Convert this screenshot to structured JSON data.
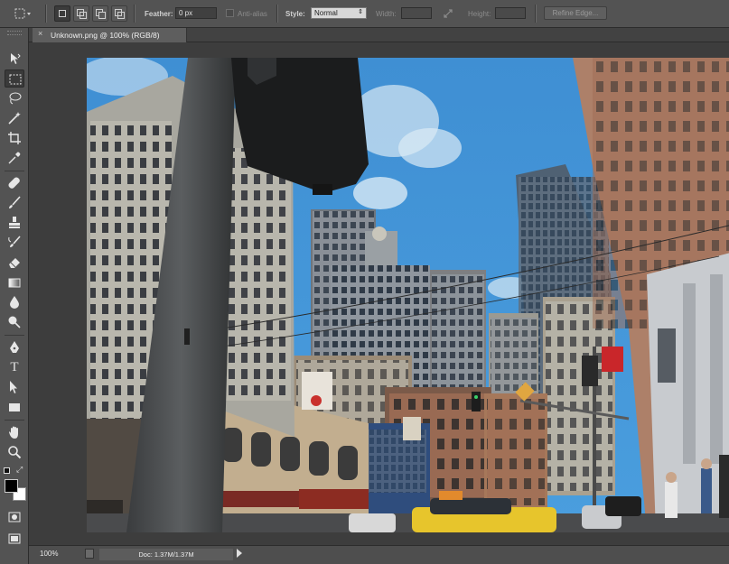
{
  "options_bar": {
    "feather_label": "Feather:",
    "feather_value": "0 px",
    "anti_alias_label": "Anti-alias",
    "style_label": "Style:",
    "style_value": "Normal",
    "width_label": "Width:",
    "height_label": "Height:",
    "refine_edge_label": "Refine Edge..."
  },
  "document": {
    "tab_title": "Unknown.png @ 100% (RGB/8)",
    "close_glyph": "×"
  },
  "status_bar": {
    "zoom": "100%",
    "doc_size": "Doc: 1.37M/1.37M"
  },
  "tools": [
    "move-tool",
    "rectangular-marquee-tool",
    "lasso-tool",
    "quick-selection-tool",
    "crop-tool",
    "eyedropper-tool",
    "spot-healing-brush-tool",
    "brush-tool",
    "clone-stamp-tool",
    "history-brush-tool",
    "eraser-tool",
    "gradient-tool",
    "blur-tool",
    "dodge-tool",
    "pen-tool",
    "type-tool",
    "path-selection-tool",
    "rectangle-tool",
    "hand-tool",
    "zoom-tool"
  ],
  "colors": {
    "foreground": "#000000",
    "background": "#ffffff",
    "sky": "#3f8fd3"
  }
}
